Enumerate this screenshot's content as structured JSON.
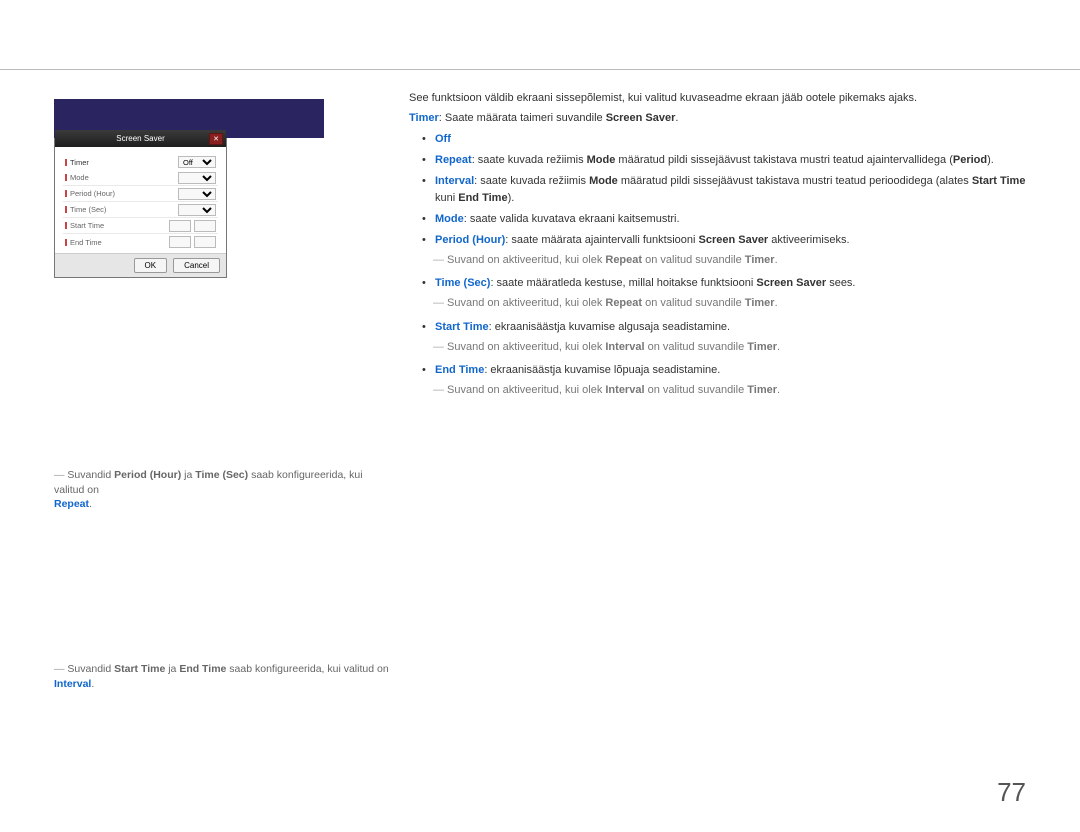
{
  "section_title": "Screen Saver",
  "dialog": {
    "title": "Screen Saver",
    "rows": {
      "timer": "Timer",
      "mode": "Mode",
      "period": "Period (Hour)",
      "time": "Time (Sec)",
      "start": "Start Time",
      "end": "End Time"
    },
    "timer_value": "Off",
    "mode_value": "",
    "ok": "OK",
    "cancel": "Cancel"
  },
  "left_notes": {
    "n1_a": "Suvandid ",
    "n1_k1": "Period (Hour)",
    "n1_b": " ja ",
    "n1_k2": "Time (Sec)",
    "n1_c": " saab konfigureerida, kui valitud on ",
    "n1_k3": "Repeat",
    "n1_dot": ".",
    "n2_a": "Suvandid ",
    "n2_k1": "Start Time",
    "n2_b": " ja ",
    "n2_k2": "End Time",
    "n2_c": " saab konfigureerida, kui valitud on ",
    "n2_k3": "Interval",
    "n2_dot": "."
  },
  "right": {
    "intro": "See funktsioon väldib ekraani sissepõlemist, kui valitud kuvaseadme ekraan jääb ootele pikemaks ajaks.",
    "timer_k": "Timer",
    "timer_txt": ": Saate määrata taimeri suvandile ",
    "timer_ss": "Screen Saver",
    "timer_dot": ".",
    "off": "Off",
    "repeat_k": "Repeat",
    "repeat_a": ": saate kuvada režiimis ",
    "repeat_mode": "Mode",
    "repeat_b": " määratud pildi sissejäävust takistava mustri teatud ajaintervallidega (",
    "repeat_period": "Period",
    "repeat_c": ").",
    "interval_k": "Interval",
    "interval_a": ": saate kuvada režiimis ",
    "interval_mode": "Mode",
    "interval_b": " määratud pildi sissejäävust takistava mustri teatud perioodidega (alates ",
    "interval_st": "Start Time",
    "interval_c": " kuni ",
    "interval_et": "End Time",
    "interval_d": ").",
    "mode_k": "Mode",
    "mode_txt": ": saate valida kuvatava ekraani kaitsemustri.",
    "ph_k": "Period (Hour)",
    "ph_a": ": saate määrata ajaintervalli funktsiooni ",
    "ph_ss": "Screen Saver",
    "ph_c": " aktiveerimiseks.",
    "sub1_a": "Suvand on aktiveeritud, kui olek ",
    "sub1_k": "Repeat",
    "sub1_b": " on valitud suvandile ",
    "sub1_timer": "Timer",
    "sub1_dot": ".",
    "ts_k": "Time (Sec)",
    "ts_a": ": saate määratleda kestuse, millal hoitakse funktsiooni ",
    "ts_ss": "Screen Saver",
    "ts_c": " sees.",
    "sub2_a": "Suvand on aktiveeritud, kui olek ",
    "sub2_k": "Repeat",
    "sub2_b": " on valitud suvandile ",
    "sub2_timer": "Timer",
    "sub2_dot": ".",
    "st_k": "Start Time",
    "st_txt": ": ekraanisäästja kuvamise algusaja seadistamine.",
    "sub3_a": "Suvand on aktiveeritud, kui olek ",
    "sub3_k": "Interval",
    "sub3_b": " on valitud suvandile ",
    "sub3_timer": "Timer",
    "sub3_dot": ".",
    "et_k": "End Time",
    "et_txt": ": ekraanisäästja kuvamise lõpuaja seadistamine.",
    "sub4_a": "Suvand on aktiveeritud, kui olek ",
    "sub4_k": "Interval",
    "sub4_b": " on valitud suvandile ",
    "sub4_timer": "Timer",
    "sub4_dot": "."
  },
  "page_number": "77"
}
